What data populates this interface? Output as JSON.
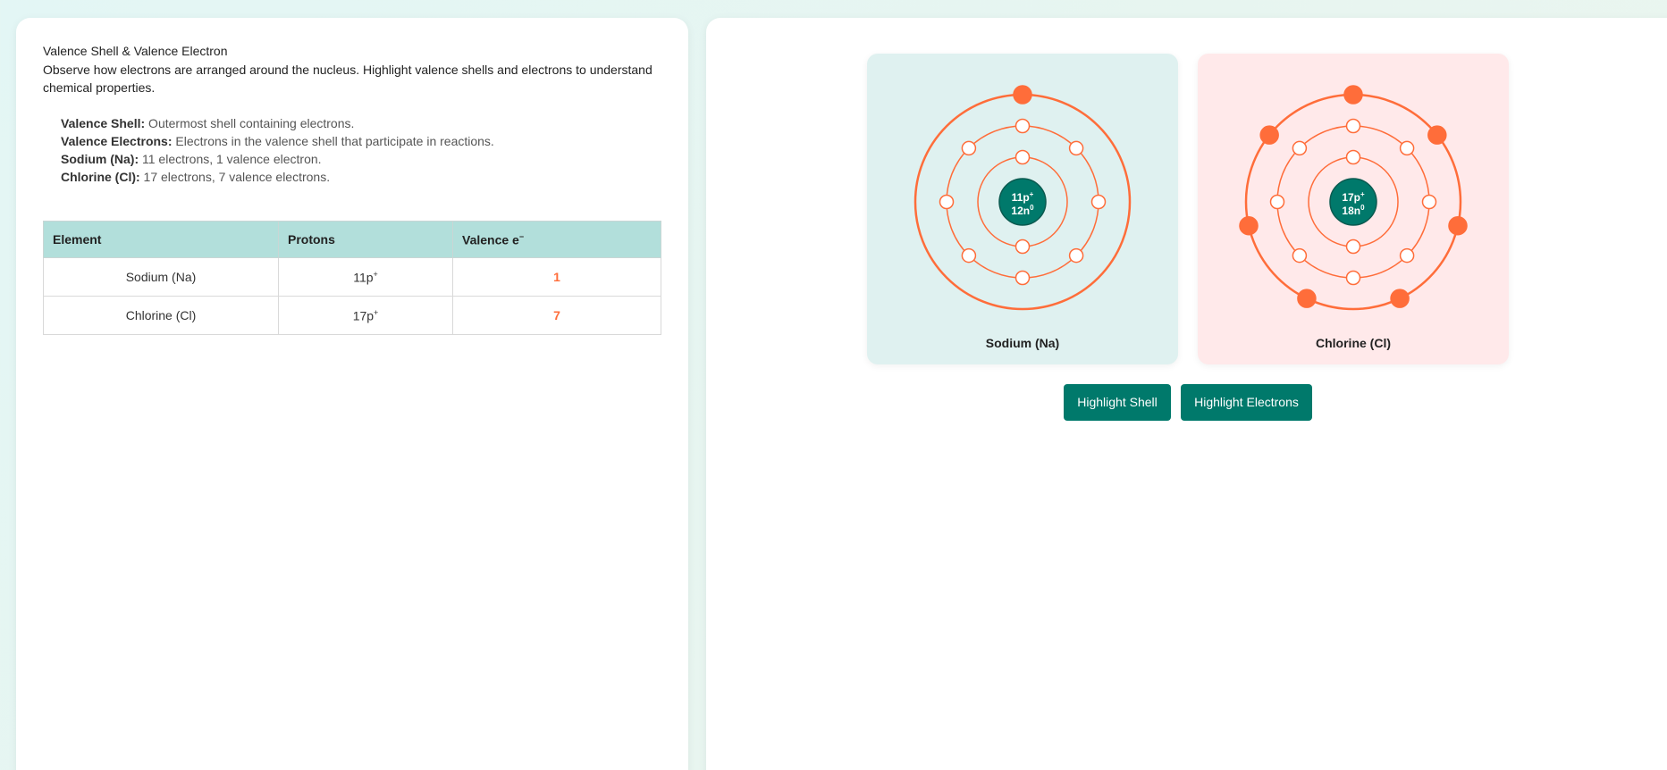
{
  "info": {
    "title": "Valence Shell & Valence Electron",
    "description": "Observe how electrons are arranged around the nucleus. Highlight valence shells and electrons to understand chemical properties.",
    "definitions": [
      {
        "term": "Valence Shell:",
        "text": " Outermost shell containing electrons."
      },
      {
        "term": "Valence Electrons:",
        "text": " Electrons in the valence shell that participate in reactions."
      },
      {
        "term": "Sodium (Na):",
        "text": " 11 electrons, 1 valence electron."
      },
      {
        "term": "Chlorine (Cl):",
        "text": " 17 electrons, 7 valence electrons."
      }
    ]
  },
  "table": {
    "headers": {
      "element": "Element",
      "protons": "Protons",
      "valence": "Valence e",
      "valence_sup": "−"
    },
    "rows": [
      {
        "element": "Sodium (Na)",
        "protons": "11p",
        "protons_sup": "+",
        "valence": "1"
      },
      {
        "element": "Chlorine (Cl)",
        "protons": "17p",
        "protons_sup": "+",
        "valence": "7"
      }
    ]
  },
  "atoms": {
    "sodium": {
      "label": "Sodium (Na)",
      "protons": "11p",
      "neutrons": "12n",
      "proton_sup": "+",
      "neutron_sup": "0",
      "shells": [
        2,
        8,
        1
      ],
      "valence_electrons": 1,
      "card_bg": "#dff1f0"
    },
    "chlorine": {
      "label": "Chlorine (Cl)",
      "protons": "17p",
      "neutrons": "18n",
      "proton_sup": "+",
      "neutron_sup": "0",
      "shells": [
        2,
        8,
        7
      ],
      "valence_electrons": 7,
      "card_bg": "#ffe9ea"
    }
  },
  "buttons": {
    "highlight_shell": "Highlight Shell",
    "highlight_electrons": "Highlight Electrons"
  },
  "colors": {
    "accent": "#ff6d3a",
    "nucleus": "#00796b",
    "button": "#00796b",
    "table_header": "#b2dfdb"
  }
}
